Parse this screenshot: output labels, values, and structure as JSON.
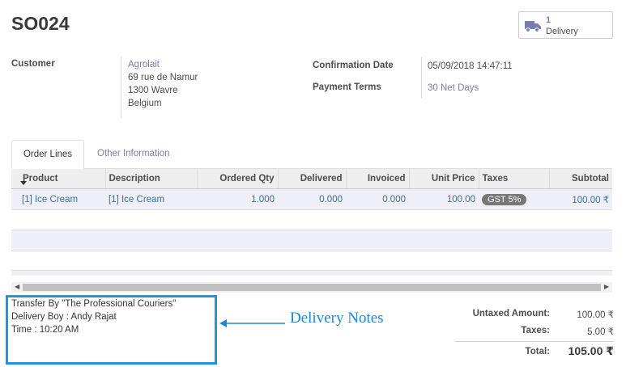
{
  "record": {
    "title": "SO024"
  },
  "smart_button": {
    "count": "1",
    "label": "Delivery"
  },
  "customer": {
    "label": "Customer",
    "name": "Agrolait",
    "address": [
      "69 rue de Namur",
      "1300 Wavre",
      "Belgium"
    ]
  },
  "info": {
    "confirmation_label": "Confirmation Date",
    "confirmation_value": "05/09/2018 14:47:11",
    "terms_label": "Payment Terms",
    "terms_value": "30 Net Days"
  },
  "tabs": [
    {
      "label": "Order Lines"
    },
    {
      "label": "Other Information"
    }
  ],
  "table": {
    "headers": [
      "Product",
      "Description",
      "Ordered Qty",
      "Delivered",
      "Invoiced",
      "Unit Price",
      "Taxes",
      "Subtotal"
    ],
    "rows": [
      {
        "product": "[1] Ice Cream",
        "description": "[1] Ice Cream",
        "ordered": "1.000",
        "delivered": "0.000",
        "invoiced": "0.000",
        "unit_price": "100.00",
        "taxes": "GST 5%",
        "subtotal": "100.00 ₹"
      }
    ]
  },
  "notes": {
    "lines": [
      "Transfer By \"The Professional Couriers\"",
      "Delivery Boy : Andy Rajat",
      "Time : 10:20 AM"
    ]
  },
  "annotation": {
    "text": "Delivery Notes",
    "color": "#1e88d4"
  },
  "totals": {
    "untaxed_label": "Untaxed Amount:",
    "untaxed_value": "100.00 ₹",
    "taxes_label": "Taxes:",
    "taxes_value": "5.00 ₹",
    "total_label": "Total:",
    "total_value": "105.00 ₹"
  },
  "icons": {
    "smart_button": "truck-icon",
    "sort": "caret-down-icon",
    "scroll_left": "arrow-left-icon",
    "scroll_right": "arrow-right-icon",
    "annotation": "arrow-left-icon"
  }
}
